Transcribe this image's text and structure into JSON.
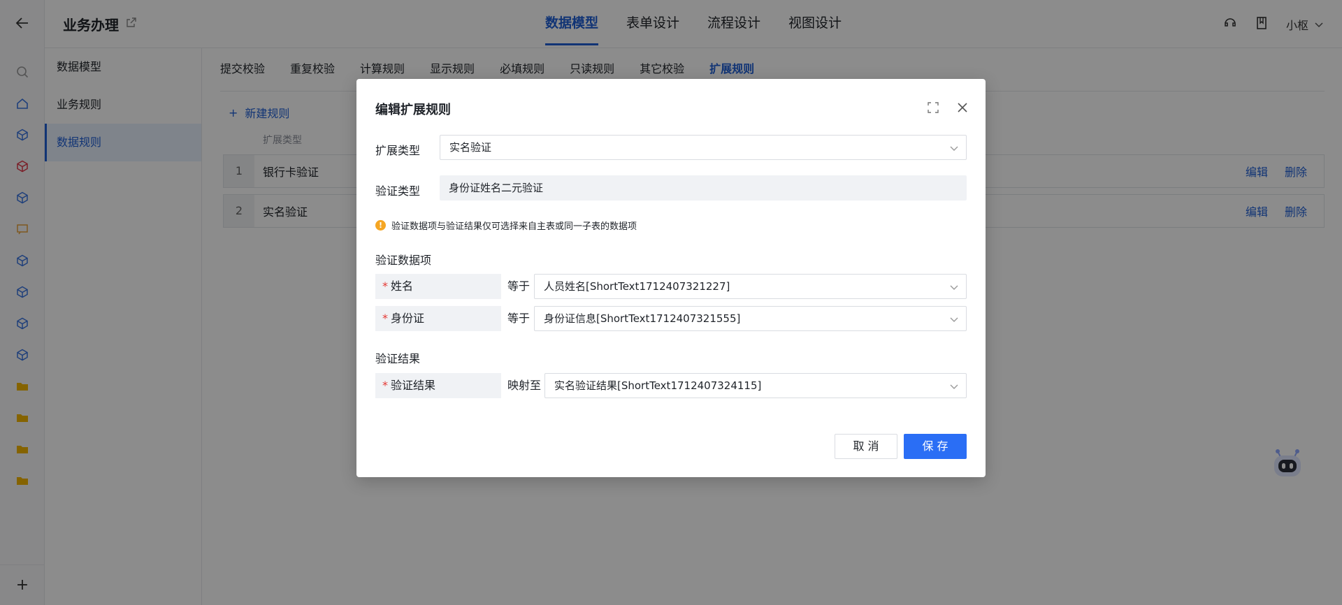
{
  "app": {
    "title": "业务办理",
    "user": "小枢"
  },
  "top_nav": {
    "items": [
      {
        "label": "数据模型"
      },
      {
        "label": "表单设计"
      },
      {
        "label": "流程设计"
      },
      {
        "label": "视图设计"
      }
    ],
    "active_index": 0
  },
  "subnav": {
    "items": [
      {
        "label": "数据模型"
      },
      {
        "label": "业务规则"
      },
      {
        "label": "数据规则"
      }
    ],
    "active_index": 2
  },
  "rule_tabs": {
    "items": [
      {
        "label": "提交校验"
      },
      {
        "label": "重复校验"
      },
      {
        "label": "计算规则"
      },
      {
        "label": "显示规则"
      },
      {
        "label": "必填规则"
      },
      {
        "label": "只读规则"
      },
      {
        "label": "其它校验"
      },
      {
        "label": "扩展规则"
      }
    ],
    "active_index": 7
  },
  "rule_list": {
    "new_label": "新建规则",
    "column_header": "扩展类型",
    "rows": [
      {
        "index": "1",
        "name": "银行卡验证",
        "edit": "编辑",
        "delete": "删除"
      },
      {
        "index": "2",
        "name": "实名验证",
        "edit": "编辑",
        "delete": "删除"
      }
    ]
  },
  "modal": {
    "title": "编辑扩展规则",
    "extend_type_label": "扩展类型",
    "extend_type_value": "实名验证",
    "verify_type_label": "验证类型",
    "verify_type_value": "身份证姓名二元验证",
    "tip": "验证数据项与验证结果仅可选择来自主表或同一子表的数据项",
    "data_items_title": "验证数据项",
    "data_items": [
      {
        "label": "姓名",
        "relation": "等于",
        "value": "人员姓名[ShortText1712407321227]"
      },
      {
        "label": "身份证",
        "relation": "等于",
        "value": "身份证信息[ShortText1712407321555]"
      }
    ],
    "result_title": "验证结果",
    "result": {
      "label": "验证结果",
      "relation": "映射至",
      "value": "实名验证结果[ShortText1712407324115]"
    },
    "cancel_label": "取 消",
    "save_label": "保 存"
  },
  "colors": {
    "accent": "#1f5fd6",
    "primary_button": "#2a6ef5",
    "warning": "#f5a623",
    "required": "#e53935",
    "overlay": "rgba(0,0,0,0.45)"
  }
}
